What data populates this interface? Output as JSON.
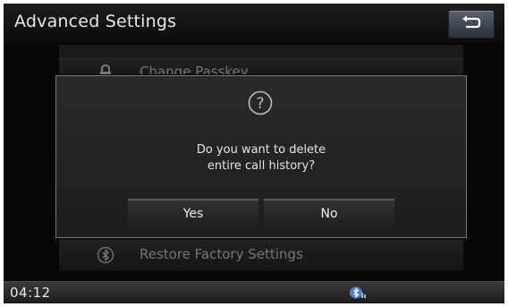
{
  "header": {
    "title": "Advanced Settings",
    "back_icon": "return-arrow-icon"
  },
  "settings_list": {
    "items": [
      {
        "label": "Change Passkey",
        "icon": "lock-icon"
      },
      {
        "label": "Restore Factory Settings",
        "icon": "bluetooth-icon"
      }
    ]
  },
  "dialog": {
    "icon": "question-icon",
    "message_line1": "Do you want to delete",
    "message_line2": "entire call history?",
    "yes_label": "Yes",
    "no_label": "No"
  },
  "status_bar": {
    "time": "04:12",
    "bluetooth_icon": "bluetooth-phone-status-icon"
  },
  "colors": {
    "background": "#0c0c0c",
    "dialog_border": "#7a7a7a",
    "back_button": "#4a5260"
  }
}
